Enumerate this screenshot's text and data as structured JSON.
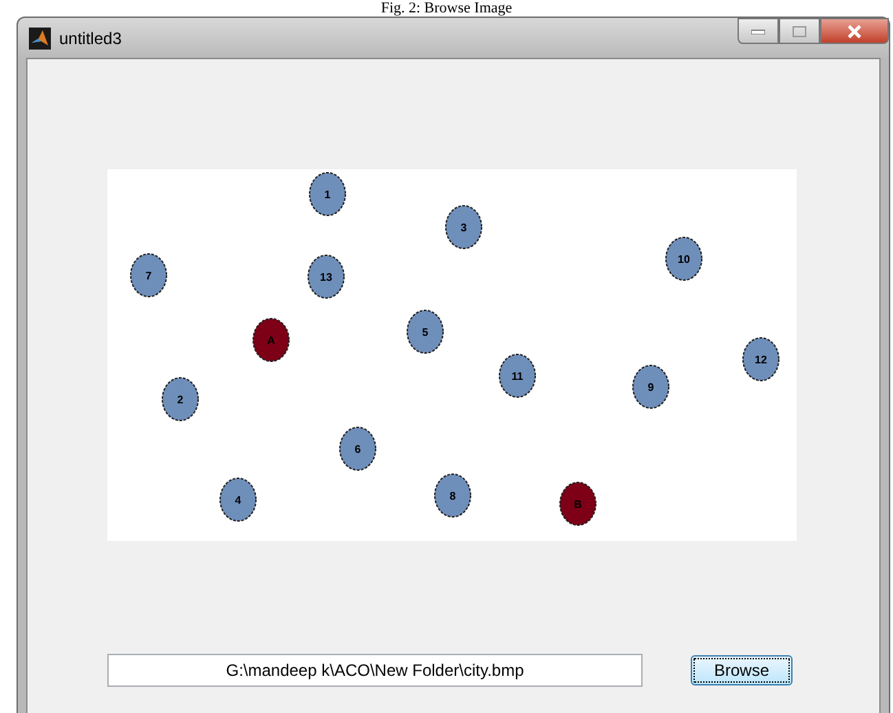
{
  "caption": "Fig. 2: Browse Image",
  "window": {
    "title": "untitled3"
  },
  "graph": {
    "nodes": [
      {
        "label": "1",
        "color": "#6f8fbb"
      },
      {
        "label": "3",
        "color": "#6f8fbb"
      },
      {
        "label": "7",
        "color": "#6f8fbb"
      },
      {
        "label": "13",
        "color": "#6f8fbb"
      },
      {
        "label": "10",
        "color": "#6f8fbb"
      },
      {
        "label": "A",
        "color": "#7d0016"
      },
      {
        "label": "5",
        "color": "#6f8fbb"
      },
      {
        "label": "12",
        "color": "#6f8fbb"
      },
      {
        "label": "11",
        "color": "#6f8fbb"
      },
      {
        "label": "9",
        "color": "#6f8fbb"
      },
      {
        "label": "2",
        "color": "#6f8fbb"
      },
      {
        "label": "6",
        "color": "#6f8fbb"
      },
      {
        "label": "4",
        "color": "#6f8fbb"
      },
      {
        "label": "8",
        "color": "#6f8fbb"
      },
      {
        "label": "B",
        "color": "#7d0016"
      }
    ]
  },
  "path_field": {
    "value": "G:\\mandeep k\\ACO\\New Folder\\city.bmp"
  },
  "buttons": [
    "Browse"
  ]
}
